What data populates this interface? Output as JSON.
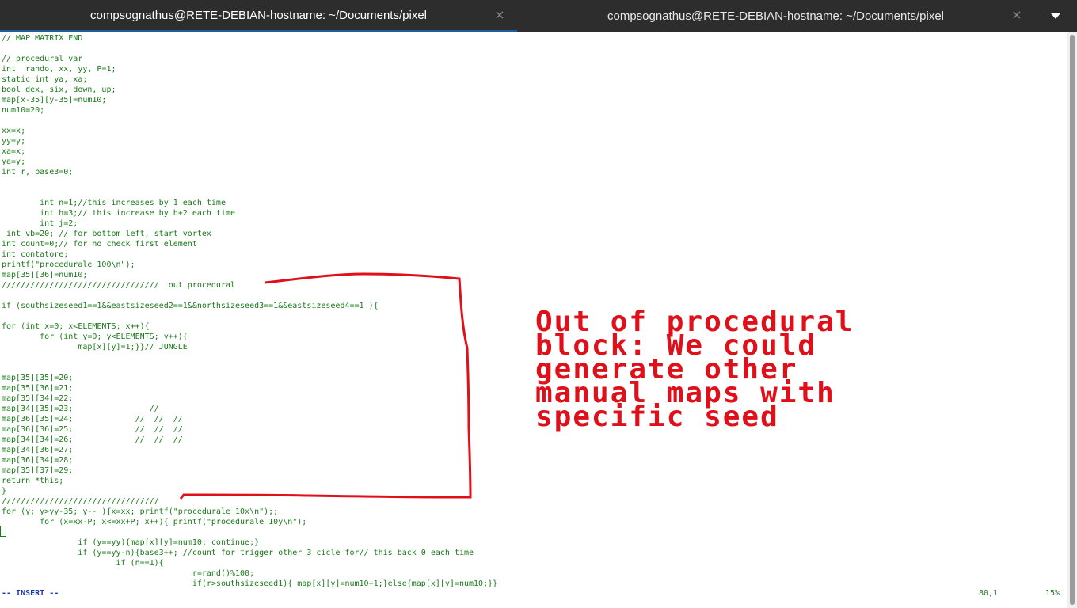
{
  "tabs": [
    {
      "title": "compsognathus@RETE-DEBIAN-hostname: ~/Documents/pixel",
      "active": true
    },
    {
      "title": "compsognathus@RETE-DEBIAN-hostname: ~/Documents/pixel",
      "active": false
    }
  ],
  "tab_close_glyph": "×",
  "code_lines": [
    "// MAP MATRIX END",
    "",
    "// procedural var",
    "int  rando, xx, yy, P=1;",
    "static int ya, xa;",
    "bool dex, six, down, up;",
    "map[x-35][y-35]=num10;",
    "num10=20;",
    "",
    "xx=x;",
    "yy=y;",
    "xa=x;",
    "ya=y;",
    "int r, base3=0;",
    "",
    "",
    "        int n=1;//this increases by 1 each time",
    "        int h=3;// this increase by h+2 each time",
    "        int j=2;",
    " int vb=20; // for bottom left, start vortex",
    "int count=0;// for no check first element",
    "int contatore;",
    "printf(\"procedurale 100\\n\");",
    "map[35][36]=num10;",
    "/////////////////////////////////  out procedural",
    "",
    "if (southsizeseed1==1&&eastsizeseed2==1&&northsizeseed3==1&&eastsizeseed4==1 ){",
    "",
    "for (int x=0; x<ELEMENTS; x++){",
    "        for (int y=0; y<ELEMENTS; y++){",
    "                map[x][y]=1;}}// JUNGLE",
    "",
    "",
    "map[35][35]=20;",
    "map[35][36]=21;",
    "map[35][34]=22;",
    "map[34][35]=23;                //",
    "map[36][35]=24;             //  //  //",
    "map[36][36]=25;             //  //  //",
    "map[34][34]=26;             //  //  //",
    "map[34][36]=27;",
    "map[36][34]=28;",
    "map[35][37]=29;",
    "return *this;",
    "}",
    "/////////////////////////////////",
    "for (y; y>yy-35; y-- ){x=xx; printf(\"procedurale 10x\\n\");;",
    "        for (x=xx-P; x<=xx+P; x++){ printf(\"procedurale 10y\\n\");",
    "",
    "                if (y==yy){map[x][y]=num10; continue;}",
    "                if (y==yy-n){base3++; //count for trigger other 3 cicle for// this back 0 each time",
    "                        if (n==1){",
    "                                        r=rand()%100;",
    "                                        if(r>southsizeseed1){ map[x][y]=num10+1;}else{map[x][y]=num10;}}"
  ],
  "status": {
    "mode": "-- INSERT --",
    "position": "80,1",
    "percent": "15%"
  },
  "annotation": {
    "lines": [
      "Out of procedural",
      "block: We could",
      "generate other",
      "manual maps with",
      "specific seed"
    ],
    "color": "#e0101a"
  },
  "colors": {
    "tabbar": "#2d2d2d",
    "active_tab_indicator": "#215d9c",
    "code_text": "#1a7a1a",
    "mode_text": "#1a3aa0"
  }
}
